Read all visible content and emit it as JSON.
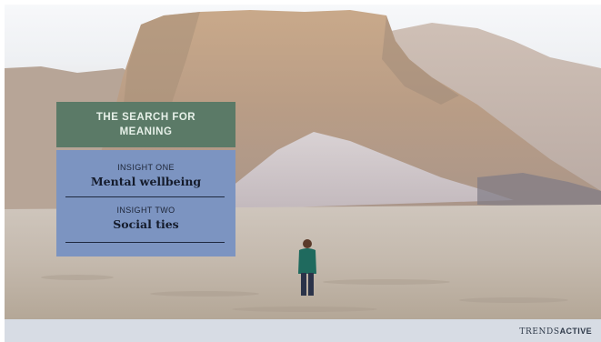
{
  "slide": {
    "title": "THE SEARCH FOR MEANING",
    "insights": [
      {
        "label": "INSIGHT ONE",
        "title": "Mental wellbeing"
      },
      {
        "label": "INSIGHT TWO",
        "title": "Social ties"
      }
    ]
  },
  "footer": {
    "brand_prefix": "TRENDS",
    "brand_suffix": "ACTIVE"
  },
  "colors": {
    "title_box": "#5b7a67",
    "insights_box": "#7c94c1",
    "footer_bar": "#d7dce4"
  }
}
